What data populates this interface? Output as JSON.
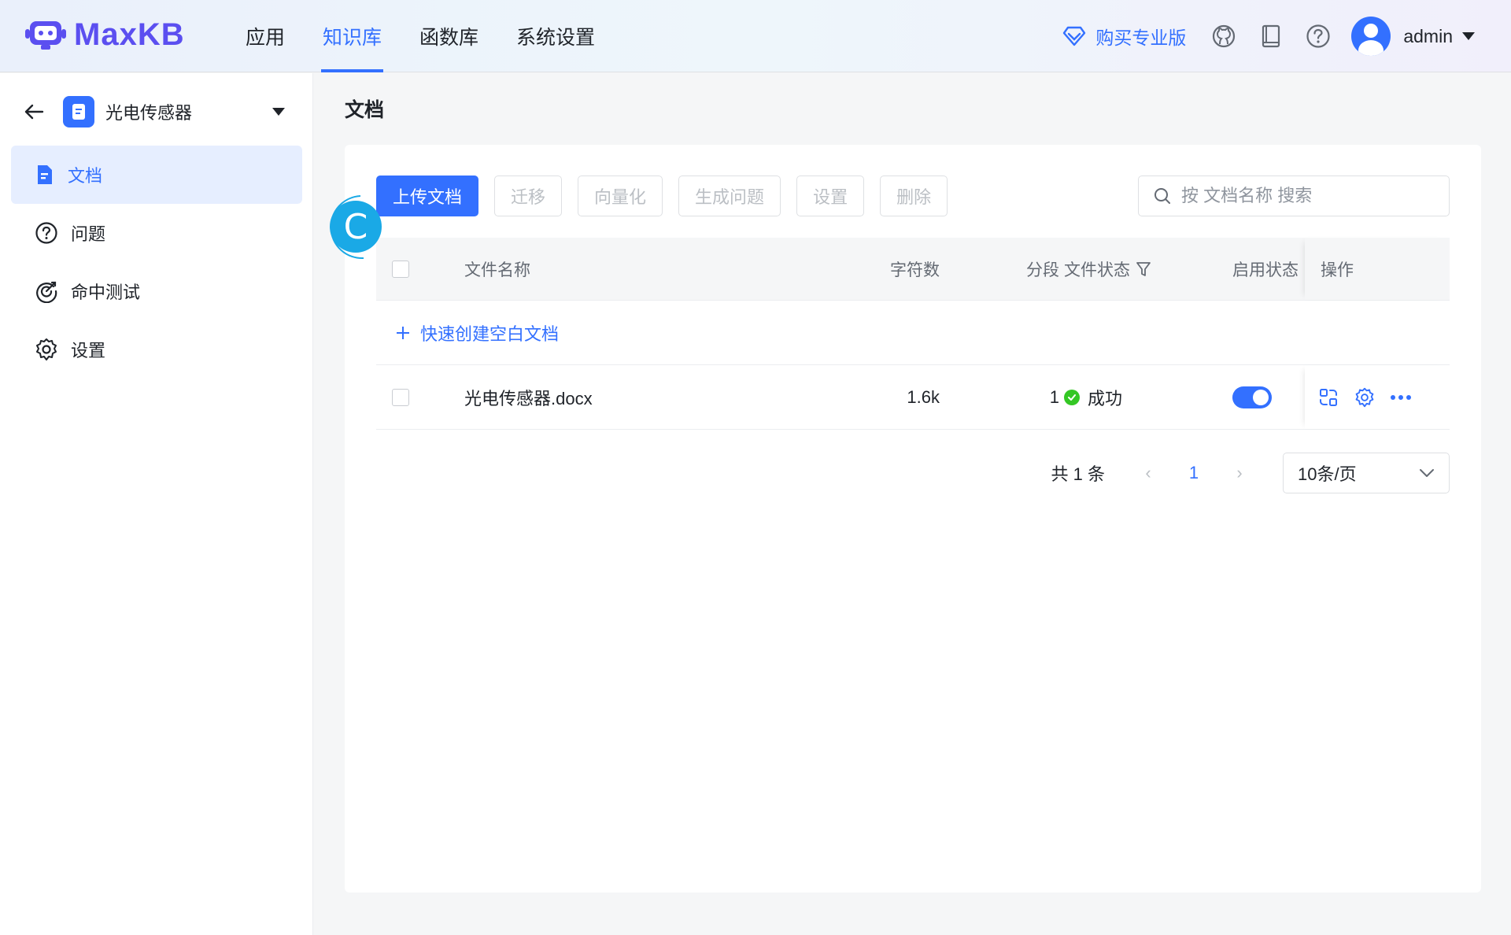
{
  "header": {
    "brand": "MaxKB",
    "nav": [
      {
        "label": "应用",
        "active": false
      },
      {
        "label": "知识库",
        "active": true
      },
      {
        "label": "函数库",
        "active": false
      },
      {
        "label": "系统设置",
        "active": false
      }
    ],
    "buy_pro": "购买专业版",
    "icons": [
      "github-icon",
      "book-icon",
      "help-icon"
    ],
    "username": "admin"
  },
  "sidebar": {
    "kb_name": "光电传感器",
    "items": [
      {
        "label": "文档",
        "icon": "document-icon",
        "active": true
      },
      {
        "label": "问题",
        "icon": "question-icon",
        "active": false
      },
      {
        "label": "命中测试",
        "icon": "target-icon",
        "active": false
      },
      {
        "label": "设置",
        "icon": "gear-icon",
        "active": false
      }
    ]
  },
  "main": {
    "title": "文档",
    "toolbar": {
      "upload": "上传文档",
      "migrate": "迁移",
      "vectorize": "向量化",
      "generate": "生成问题",
      "settings": "设置",
      "delete": "删除"
    },
    "search": {
      "placeholder": "按 文档名称 搜索"
    },
    "table": {
      "headers": {
        "name": "文件名称",
        "chars": "字符数",
        "segments": "分段",
        "file_status": "文件状态",
        "enable_status": "启用状态",
        "actions": "操作"
      },
      "quick_create": "快速创建空白文档",
      "rows": [
        {
          "name": "光电传感器.docx",
          "chars": "1.6k",
          "segments": "1",
          "status": "成功",
          "enabled": true
        }
      ]
    },
    "pagination": {
      "total": "共 1 条",
      "current_page": "1",
      "page_size": "10条/页"
    }
  },
  "cursor": {
    "letter": "C"
  },
  "colors": {
    "accent": "#3370ff",
    "brand": "#5b4ff0",
    "success": "#34c724",
    "cursor": "#1aa9e6"
  }
}
